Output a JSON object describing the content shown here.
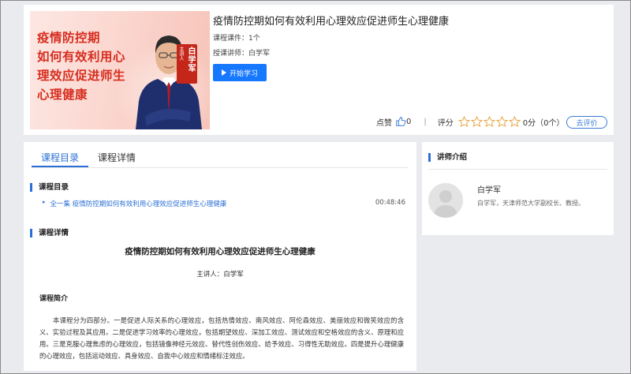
{
  "course": {
    "cover_title_lines": [
      "疫情防控期",
      "如何有效利用心",
      "理效应促进师生",
      "心理健康"
    ],
    "cover_lecturer_role": "主讲人",
    "cover_lecturer_name": "白学军",
    "title": "疫情防控期如何有效利用心理效应促进师生心理健康",
    "courseware_count": "课程课件：1个",
    "lecturer": "授课讲师：白学军",
    "start_button": "开始学习"
  },
  "rating": {
    "like_label": "点赞",
    "like_count": "0",
    "separator": "|",
    "score_label": "评分",
    "score": "0分",
    "count": "（0个）",
    "stars_filled": 0,
    "stars_total": 5,
    "evaluate_button": "去评价"
  },
  "tabs": [
    {
      "label": "课程目录",
      "active": true
    },
    {
      "label": "课程详情",
      "active": false
    }
  ],
  "catalog": {
    "heading": "课程目录",
    "items": [
      {
        "arrow": "▸",
        "label": "全一集 疫情防控期如何有效利用心理效应促进师生心理健康",
        "duration": "00:48:46"
      }
    ]
  },
  "detail": {
    "heading": "课程详情",
    "title": "疫情防控期如何有效利用心理效应促进师生心理健康",
    "lecturer": "主讲人：白学军",
    "intro_heading": "课程简介",
    "intro_text": "本课程分为四部分。一是促进人际关系的心理效应，包括热情效应、南风效应、阿伦森效应、美丽效应和微笑效应的含义、实验过程及其应用。二是促进学习效率的心理效应，包括期望效应、深加工效应、测试效应和空格效应的含义、原理和应用。三是克服心理焦虑的心理效应，包括镜像神经元效应、替代性创伤效应、给予效应、习得性无助效应。四是提升心理健康的心理效应，包括运动效应、具身效应、自我中心效应和情绪标注效应。"
  },
  "teacher": {
    "heading": "讲师介绍",
    "name": "白学军",
    "description": "白学军，天津师范大学副校长、教授。"
  },
  "colors": {
    "accent": "#2b6fd6",
    "primary_button": "#1677ff",
    "cover_red": "#d62d1f"
  }
}
